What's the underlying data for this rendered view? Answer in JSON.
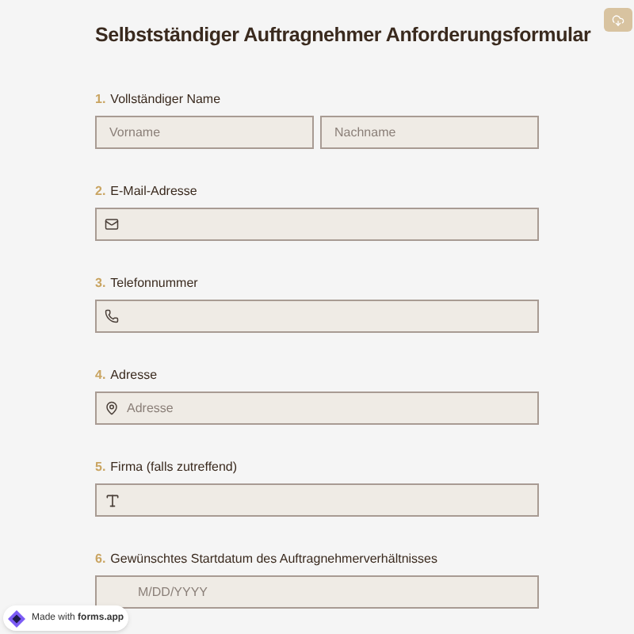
{
  "title": "Selbstständiger Auftragnehmer Anforderungsformular",
  "questions": [
    {
      "number": "1.",
      "label": "Vollständiger Name",
      "kind": "name",
      "placeholders": [
        "Vorname",
        "Nachname"
      ]
    },
    {
      "number": "2.",
      "label": "E-Mail-Adresse",
      "kind": "email"
    },
    {
      "number": "3.",
      "label": "Telefonnummer",
      "kind": "phone"
    },
    {
      "number": "4.",
      "label": "Adresse",
      "kind": "address",
      "placeholders": [
        "Adresse"
      ]
    },
    {
      "number": "5.",
      "label": "Firma (falls zutreffend)",
      "kind": "text"
    },
    {
      "number": "6.",
      "label": "Gewünschtes Startdatum des Auftragnehmerverhältnisses",
      "kind": "date",
      "placeholders": [
        "M/DD/YYYY"
      ]
    }
  ],
  "badge": {
    "prefix": "Made with",
    "brand": "forms.app"
  }
}
